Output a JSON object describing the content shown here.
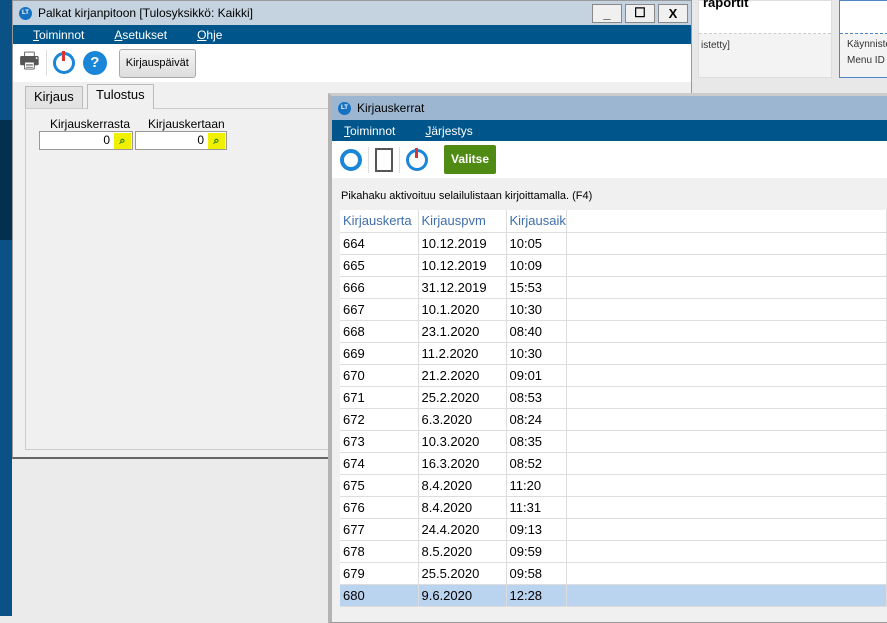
{
  "background_window": {
    "heading": "raportit",
    "status": "istetty]",
    "side_line1": "Käynnistetty",
    "side_line2": "Menu ID"
  },
  "main_window": {
    "title": "Palkat kirjanpitoon [Tulosyksikkö: Kaikki]",
    "controls": [
      "_",
      "☐",
      "X"
    ],
    "menu": [
      "Toiminnot",
      "Asetukset",
      "Ohje"
    ],
    "toolbar": {
      "button": "Kirjauspäivät"
    },
    "tabs": [
      "Kirjaus",
      "Tulostus"
    ],
    "active_tab": "Tulostus",
    "fields": [
      {
        "label": "Kirjauskerrasta",
        "value": "0"
      },
      {
        "label": "Kirjauskertaan",
        "value": "0"
      }
    ]
  },
  "dialog": {
    "title": "Kirjauskerrat",
    "menu": [
      "Toiminnot",
      "Järjestys"
    ],
    "select_button": "Valitse",
    "hint": "Pikahaku aktivoituu selailulistaan kirjoittamalla. (F4)",
    "columns": [
      "Kirjauskerta",
      "Kirjauspvm",
      "Kirjausaik"
    ],
    "rows": [
      [
        "664",
        "10.12.2019",
        "10:05"
      ],
      [
        "665",
        "10.12.2019",
        "10:09"
      ],
      [
        "666",
        "31.12.2019",
        "15:53"
      ],
      [
        "667",
        "10.1.2020",
        "10:30"
      ],
      [
        "668",
        "23.1.2020",
        "08:40"
      ],
      [
        "669",
        "11.2.2020",
        "10:30"
      ],
      [
        "670",
        "21.2.2020",
        "09:01"
      ],
      [
        "671",
        "25.2.2020",
        "08:53"
      ],
      [
        "672",
        "6.3.2020",
        "08:24"
      ],
      [
        "673",
        "10.3.2020",
        "08:35"
      ],
      [
        "674",
        "16.3.2020",
        "08:52"
      ],
      [
        "675",
        "8.4.2020",
        "11:20"
      ],
      [
        "676",
        "8.4.2020",
        "11:31"
      ],
      [
        "677",
        "24.4.2020",
        "09:13"
      ],
      [
        "678",
        "8.5.2020",
        "09:59"
      ],
      [
        "679",
        "25.5.2020",
        "09:58"
      ],
      [
        "680",
        "9.6.2020",
        "12:28"
      ]
    ],
    "selected_row": "680"
  }
}
